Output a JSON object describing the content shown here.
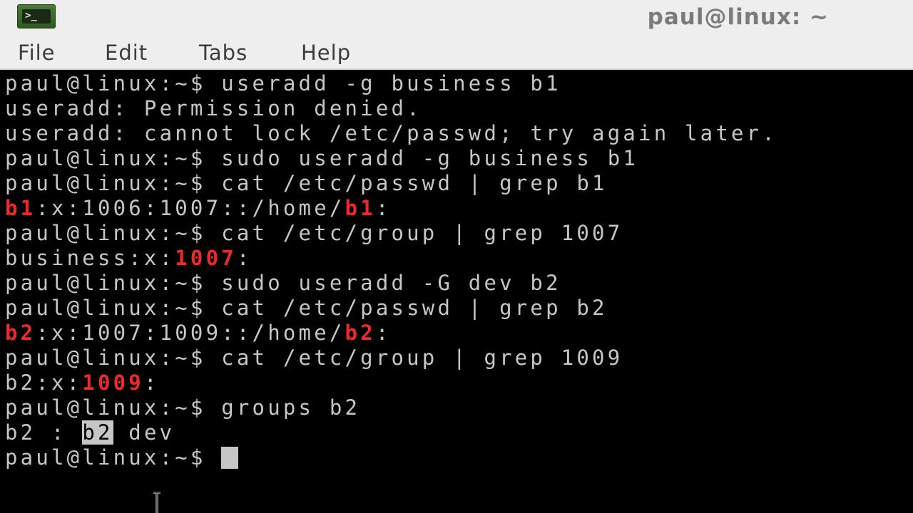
{
  "window": {
    "title": "paul@linux: ~",
    "app_icon_text": ">_"
  },
  "menu": {
    "items": [
      "File",
      "Edit",
      "Tabs",
      "Help"
    ]
  },
  "terminal": {
    "lines": [
      "paul@linux:~$ useradd -g business b1",
      "useradd: Permission denied.",
      "useradd: cannot lock /etc/passwd; try again later.",
      "paul@linux:~$ sudo useradd -g business b1",
      "paul@linux:~$ cat /etc/passwd | grep b1",
      "b1:x:1006:1007::/home/b1:",
      "paul@linux:~$ cat /etc/group | grep 1007",
      "business:x:1007:",
      "paul@linux:~$ sudo useradd -G dev b2",
      "paul@linux:~$ cat /etc/passwd | grep b2",
      "b2:x:1007:1009::/home/b2:",
      "paul@linux:~$ cat /etc/group | grep 1009",
      "b2:x:1009:",
      "paul@linux:~$ groups b2",
      "b2 : b2 dev",
      "paul@linux:~$ "
    ],
    "colors": {
      "background": "#000000",
      "foreground": "#c6c6c6",
      "match_highlight": "#ef2929"
    }
  }
}
